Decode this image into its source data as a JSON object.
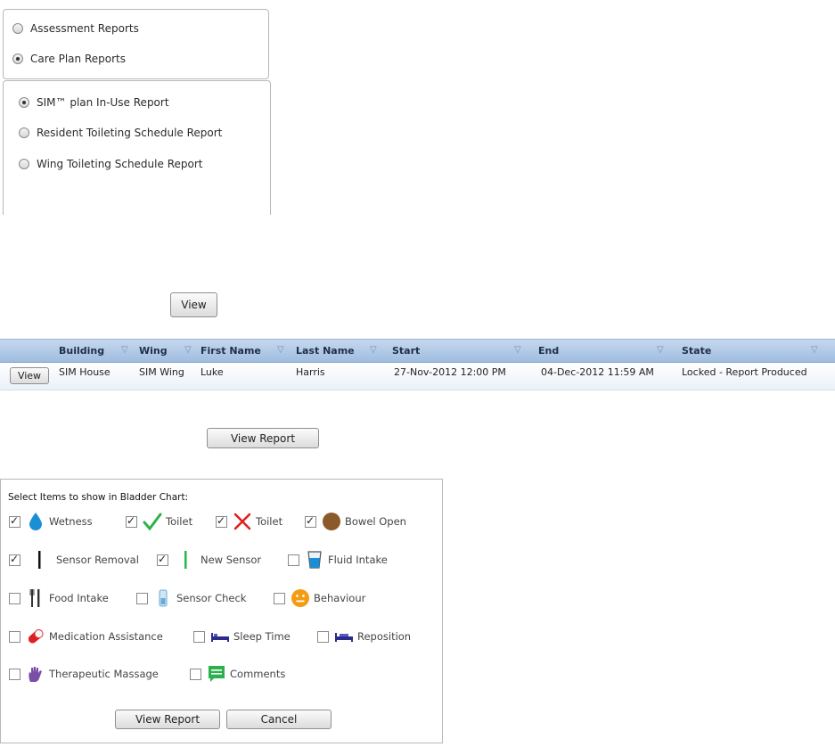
{
  "report_category": {
    "options": [
      {
        "label": "Assessment Reports",
        "checked": false
      },
      {
        "label": "Care Plan Reports",
        "checked": true
      }
    ]
  },
  "report_type": {
    "options": [
      {
        "label": "SIM™ plan In-Use Report",
        "checked": true
      },
      {
        "label": "Resident Toileting Schedule Report",
        "checked": false
      },
      {
        "label": "Wing Toileting Schedule Report",
        "checked": false
      }
    ]
  },
  "view_button_label": "View",
  "grid": {
    "headers": [
      "Building",
      "Wing",
      "First Name",
      "Last Name",
      "Start",
      "End",
      "State"
    ],
    "row": {
      "action": "View",
      "building": "SIM House",
      "wing": "SIM Wing",
      "first_name": "Luke",
      "last_name": "Harris",
      "start": "27-Nov-2012 12:00 PM",
      "end": "04-Dec-2012 11:59 AM",
      "state": "Locked - Report Produced"
    }
  },
  "view_report_label": "View Report",
  "chart_dialog": {
    "title": "Select Items to show in Bladder Chart:",
    "items": [
      {
        "label": "Wetness",
        "checked": true,
        "icon": "water-drop-icon"
      },
      {
        "label": "Toilet",
        "checked": true,
        "icon": "green-check-icon"
      },
      {
        "label": "Toilet",
        "checked": true,
        "icon": "red-cross-icon"
      },
      {
        "label": "Bowel Open",
        "checked": true,
        "icon": "brown-circle-icon"
      },
      {
        "label": "Sensor Removal",
        "checked": true,
        "icon": "black-bar-icon"
      },
      {
        "label": "New Sensor",
        "checked": true,
        "icon": "green-bar-icon"
      },
      {
        "label": "Fluid Intake",
        "checked": false,
        "icon": "glass-icon"
      },
      {
        "label": "Food Intake",
        "checked": false,
        "icon": "cutlery-icon"
      },
      {
        "label": "Sensor Check",
        "checked": false,
        "icon": "sensor-icon"
      },
      {
        "label": "Behaviour",
        "checked": false,
        "icon": "smiley-icon"
      },
      {
        "label": "Medication Assistance",
        "checked": false,
        "icon": "pill-icon"
      },
      {
        "label": "Sleep Time",
        "checked": false,
        "icon": "bed-icon"
      },
      {
        "label": "Reposition",
        "checked": false,
        "icon": "reposition-bed-icon"
      },
      {
        "label": "Therapeutic Massage",
        "checked": false,
        "icon": "hand-icon"
      },
      {
        "label": "Comments",
        "checked": false,
        "icon": "speech-bubble-icon"
      }
    ],
    "view_report_label": "View Report",
    "cancel_label": "Cancel"
  },
  "colors": {
    "grid_header": "#b3cbe8",
    "check_green": "#2bb24c",
    "cross_red": "#e02020",
    "drop_blue": "#1a8fd6",
    "bowel_brown": "#8b5a2b"
  }
}
